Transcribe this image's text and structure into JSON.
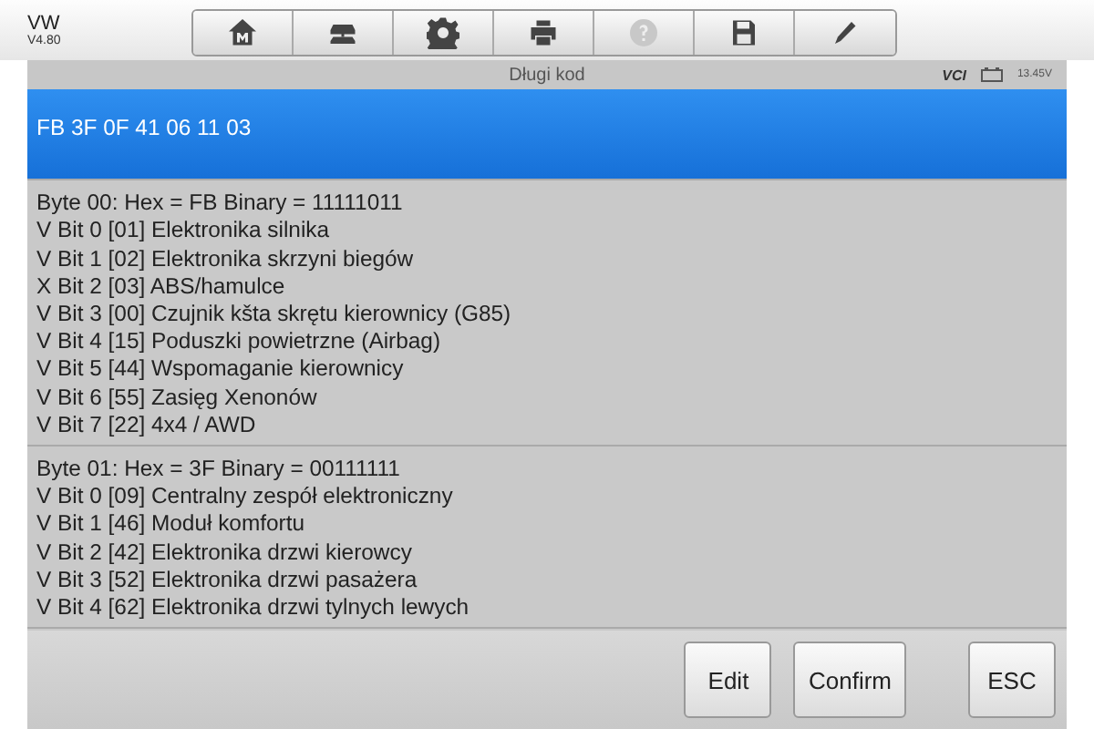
{
  "header": {
    "title": "VW",
    "version": "V4.80"
  },
  "toolbar": [
    {
      "kind": "home",
      "disabled": false
    },
    {
      "kind": "cars",
      "disabled": false
    },
    {
      "kind": "settings",
      "disabled": false
    },
    {
      "kind": "print",
      "disabled": false
    },
    {
      "kind": "help",
      "disabled": true
    },
    {
      "kind": "save",
      "disabled": false
    },
    {
      "kind": "edit",
      "disabled": false
    }
  ],
  "status_bar": {
    "title": "Długi kod",
    "vci": "VCI",
    "voltage": "13.45V"
  },
  "entries": [
    {
      "selected": true,
      "lines": [
        "FB 3F 0F 41 06 11 03"
      ]
    },
    {
      "selected": false,
      "lines": [
        "Byte 00: Hex = FB  Binary = 11111011",
        "V Bit 0 [01] Elektronika silnika",
        "V Bit 1 [02] Elektronika skrzyni biegów",
        "X Bit 2 [03] ABS/hamulce",
        "V Bit 3 [00] Czujnik kšta skrętu kierownicy (G85)",
        "V Bit 4 [15] Poduszki powietrzne (Airbag)",
        "V Bit 5 [44] Wspomaganie kierownicy",
        "V Bit 6 [55] Zasięg Xenonów",
        "V Bit 7 [22] 4x4 / AWD"
      ]
    },
    {
      "selected": false,
      "lines": [
        "Byte 01: Hex = 3F  Binary = 00111111",
        "V Bit 0 [09] Centralny zespół elektroniczny",
        "V Bit 1 [46] Moduł komfortu",
        "V Bit 2 [42] Elektronika drzwi kierowcy",
        "V Bit 3 [52] Elektronika drzwi pasażera",
        "V Bit 4 [62] Elektronika drzwi tylnych lewych"
      ]
    }
  ],
  "buttons": [
    {
      "label": "Edit",
      "kind": "action"
    },
    {
      "label": "Confirm",
      "kind": "action"
    },
    {
      "label": "ESC",
      "kind": "exit"
    }
  ]
}
